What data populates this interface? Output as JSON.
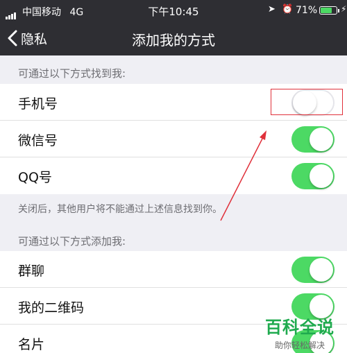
{
  "status_bar": {
    "carrier": "中国移动",
    "network": "4G",
    "time": "下午10:45",
    "battery": "71%",
    "battery_level": 0.71,
    "icons": [
      "signal-icon",
      "location-icon",
      "alarm-icon",
      "battery-icon",
      "charging-icon"
    ]
  },
  "nav": {
    "back_label": "隐私",
    "title": "添加我的方式"
  },
  "find_section": {
    "header": "可通过以下方式找到我:",
    "items": [
      {
        "label": "手机号",
        "on": false
      },
      {
        "label": "微信号",
        "on": true
      },
      {
        "label": "QQ号",
        "on": true
      }
    ],
    "footnote": "关闭后，其他用户将不能通过上述信息找到你。"
  },
  "add_section": {
    "header": "可通过以下方式添加我:",
    "items": [
      {
        "label": "群聊",
        "on": true
      },
      {
        "label": "我的二维码",
        "on": true
      },
      {
        "label": "名片",
        "on": true
      }
    ]
  },
  "watermark": {
    "title": "百科全说",
    "subtitle": "助你轻松解决"
  },
  "colors": {
    "bar_bg": "#2e2e33",
    "toggle_on": "#4cd964",
    "annotation": "#e0303a",
    "watermark": "#1faa4e"
  }
}
